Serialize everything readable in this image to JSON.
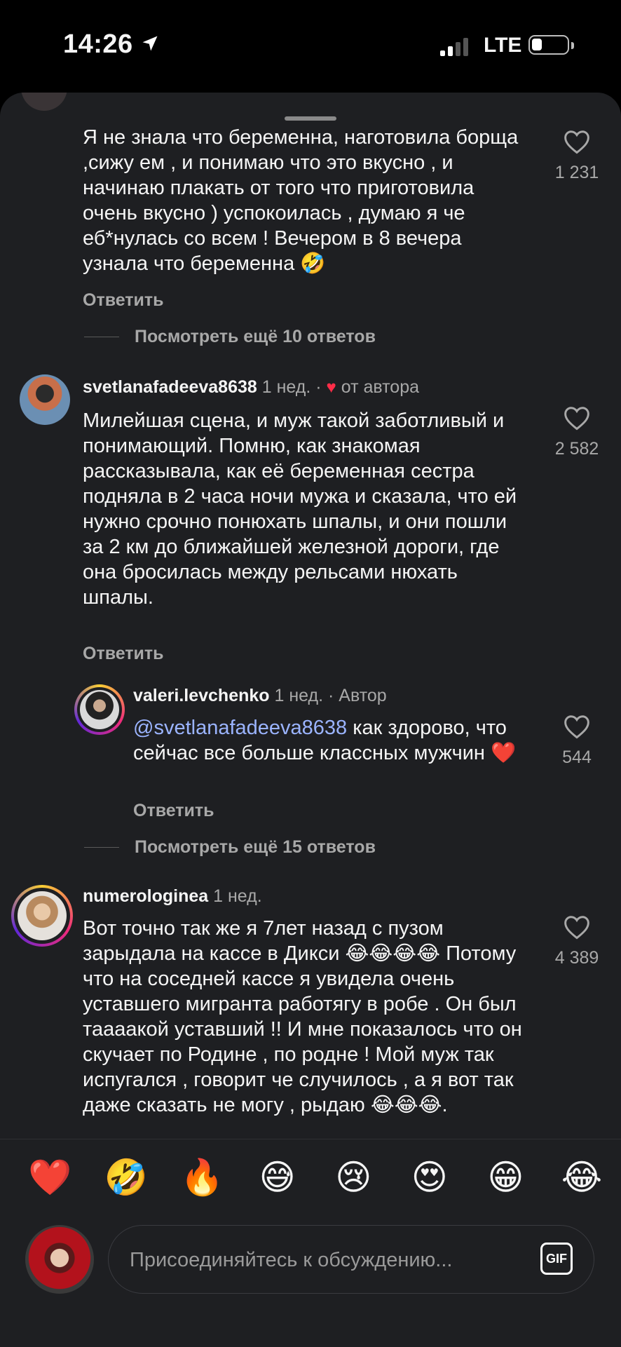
{
  "status_bar": {
    "time": "14:26",
    "network": "LTE"
  },
  "comments": [
    {
      "text": "Я не знала что беременна, наготовила борща ,сижу ем , и понимаю что это вкусно , и начинаю плакать от того что приготовила очень вкусно ) успокоилась , думаю я че еб*нулась со  всем ! Вечером в 8 вечера узнала что беременна 🤣",
      "reply": "Ответить",
      "likes": "1 231",
      "view_more": "Посмотреть ещё 10 ответов"
    },
    {
      "username": "svetlanafadeeva8638",
      "time": "1 нед.",
      "dot": "·",
      "liked_heart": "♥",
      "liked_by_author": "от автора",
      "text": "Милейшая сцена, и муж такой заботливый и понимающий. Помню, как знакомая рассказывала, как её беременная сестра подняла в 2 часа ночи мужа и сказала, что ей нужно срочно понюхать шпалы, и они пошли за 2 км до ближайшей железной дороги, где она бросилась между рельсами нюхать шпалы.",
      "reply": "Ответить",
      "likes": "2 582",
      "reply_item": {
        "username": "valeri.levchenko",
        "time": "1 нед.",
        "dot": "·",
        "author_tag": "Автор",
        "mention": "@svetlanafadeeva8638",
        "text": " как здорово, что сейчас все больше классных мужчин ❤️",
        "reply": "Ответить",
        "likes": "544"
      },
      "view_more": "Посмотреть ещё 15 ответов"
    },
    {
      "username": "numerologinea",
      "time": "1 нед.",
      "text": "Вот точно так же я 7лет назад  с пузом зарыдала на кассе в Дикси 😂😂😂😂 Потому что на соседней кассе я увидела очень уставшего мигранта работягу в робе . Он был таааакой уставший !! И мне показалось что он скучает по Родине , по родне ! Мой муж так испугался , говорит че случилось , а я вот так даже сказать не могу , рыдаю 😂😂😂.",
      "likes": "4 389"
    }
  ],
  "emoji_bar": [
    "❤️",
    "🤣",
    "🔥",
    "😅",
    "😢",
    "😍",
    "😁",
    "😂"
  ],
  "composer": {
    "placeholder": "Присоединяйтесь к обсуждению...",
    "gif_label": "GIF"
  },
  "colors": {
    "sheet": "#1e1f22",
    "secondary_text": "#a8a8a8",
    "mention": "#9bb4ff",
    "like_red": "#ff2d48"
  }
}
